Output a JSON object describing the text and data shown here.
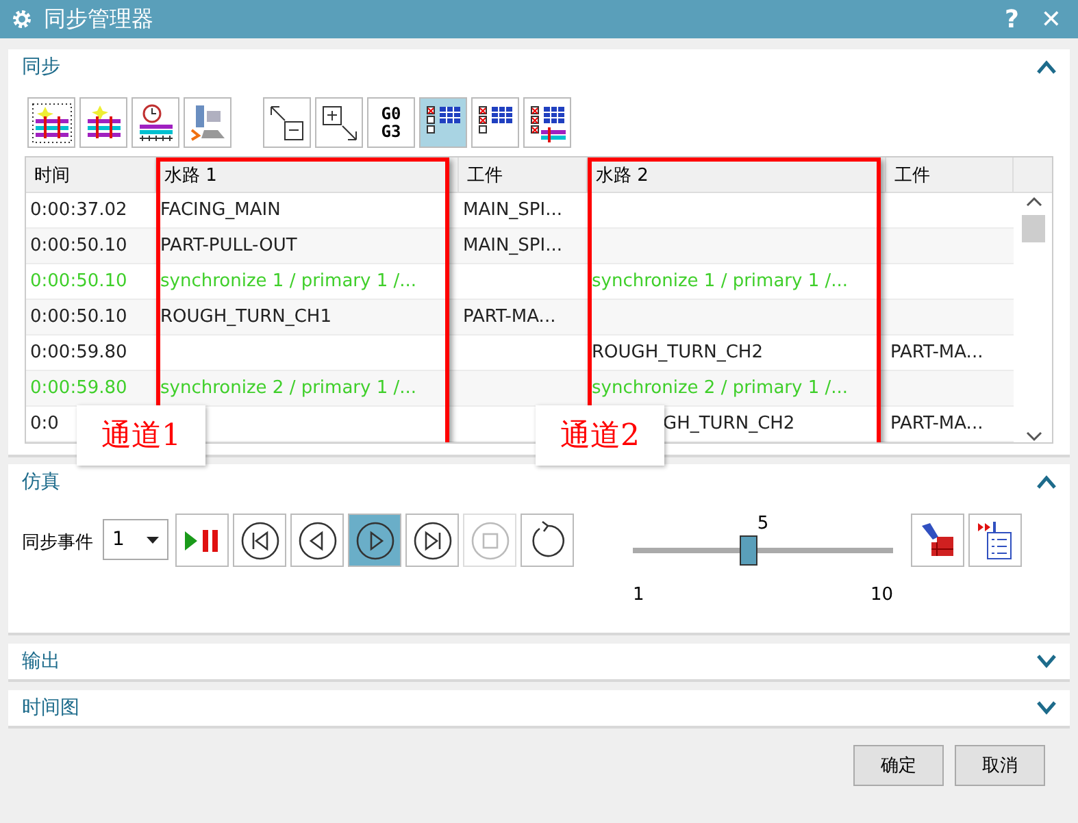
{
  "window": {
    "title": "同步管理器",
    "help": "?",
    "close": "✕"
  },
  "sync_panel": {
    "title": "同步",
    "expanded": true,
    "tools": [
      {
        "kind": "stripes-dotted",
        "selected": false
      },
      {
        "kind": "stripes-star",
        "selected": false
      },
      {
        "kind": "clock",
        "selected": false
      },
      {
        "kind": "machine",
        "selected": false
      },
      {
        "kind": "collapse",
        "selected": false
      },
      {
        "kind": "expand",
        "selected": false
      },
      {
        "kind": "text",
        "label": "G0\nG3",
        "selected": false
      },
      {
        "kind": "list-one",
        "selected": true
      },
      {
        "kind": "list-two",
        "selected": false
      },
      {
        "kind": "list-three",
        "selected": false
      }
    ],
    "table": {
      "columns": [
        "时间",
        "水路 1",
        "工件",
        "水路 2",
        "工件"
      ],
      "rows": [
        {
          "sync": false,
          "cells": [
            "0:00:37.02",
            "FACING_MAIN",
            "MAIN_SPI...",
            "",
            ""
          ]
        },
        {
          "sync": false,
          "cells": [
            "0:00:50.10",
            "PART-PULL-OUT",
            "MAIN_SPI...",
            "",
            ""
          ]
        },
        {
          "sync": true,
          "cells": [
            "0:00:50.10",
            "synchronize 1 / primary 1 /...",
            "",
            "synchronize 1 / primary 1 /...",
            ""
          ]
        },
        {
          "sync": false,
          "cells": [
            "0:00:50.10",
            "ROUGH_TURN_CH1",
            "PART-MA...",
            "",
            ""
          ]
        },
        {
          "sync": false,
          "cells": [
            "0:00:59.80",
            "",
            "",
            "ROUGH_TURN_CH2",
            "PART-MA..."
          ]
        },
        {
          "sync": true,
          "cells": [
            "0:00:59.80",
            "synchronize 2 / primary 1 /...",
            "",
            "synchronize 2 / primary 1 /...",
            ""
          ]
        },
        {
          "sync": false,
          "cells": [
            "0:0",
            "",
            "",
            "GH_TURN_CH2",
            "PART-MA..."
          ]
        }
      ]
    },
    "annotations": [
      {
        "label": "通道1"
      },
      {
        "label": "通道2"
      }
    ]
  },
  "sim_panel": {
    "title": "仿真",
    "expanded": true,
    "event_label": "同步事件",
    "event_value": "1",
    "controls": [
      {
        "kind": "play-pause",
        "selected": false,
        "disabled": false
      },
      {
        "kind": "first",
        "selected": false,
        "disabled": false
      },
      {
        "kind": "prev",
        "selected": false,
        "disabled": false
      },
      {
        "kind": "play",
        "selected": true,
        "disabled": false
      },
      {
        "kind": "next",
        "selected": false,
        "disabled": false
      },
      {
        "kind": "stop",
        "selected": false,
        "disabled": true
      },
      {
        "kind": "reset",
        "selected": false,
        "disabled": false
      }
    ],
    "slider": {
      "value": "5",
      "min": "1",
      "max": "10",
      "level": 0.444
    },
    "extra_tools": [
      {
        "kind": "flashlight"
      },
      {
        "kind": "list-run"
      }
    ]
  },
  "collapsed_panels": [
    {
      "title": "输出",
      "expanded": false
    },
    {
      "title": "时间图",
      "expanded": false
    }
  ],
  "buttons": [
    "确定",
    "取消"
  ]
}
